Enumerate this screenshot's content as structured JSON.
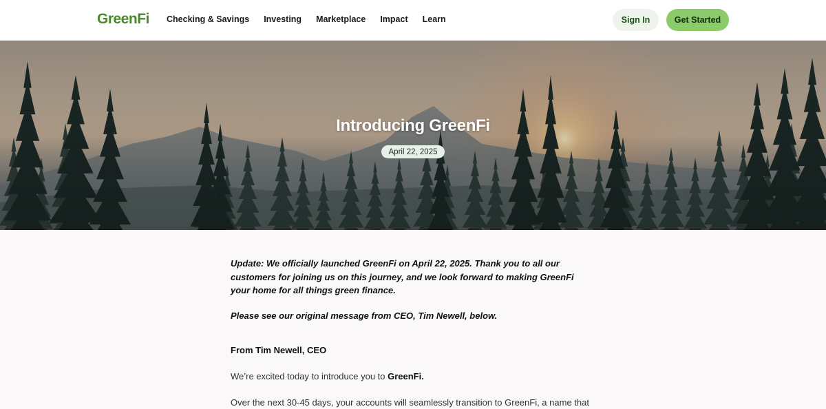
{
  "header": {
    "logo": "GreenFi",
    "nav": [
      "Checking & Savings",
      "Investing",
      "Marketplace",
      "Impact",
      "Learn"
    ],
    "sign_in": "Sign In",
    "get_started": "Get Started"
  },
  "hero": {
    "title": "Introducing GreenFi",
    "date": "April 22, 2025"
  },
  "article": {
    "update_note": "Update: We officially launched GreenFi on April 22, 2025. Thank you to all our customers for joining us on this journey, and we look forward to making GreenFi your home for all things green finance.",
    "see_message": "Please see our original message from CEO, Tim Newell, below.",
    "byline": "From Tim Newell, CEO",
    "intro_prefix": "We’re excited today to introduce you to ",
    "intro_brand": "GreenFi.",
    "next_para": "Over the next 30-45 days, your accounts will seamlessly transition to GreenFi, a name that"
  },
  "colors": {
    "brand_green": "#4a8a2c",
    "cta_green": "#8ccb6a",
    "signin_bg": "#eef4ec"
  }
}
